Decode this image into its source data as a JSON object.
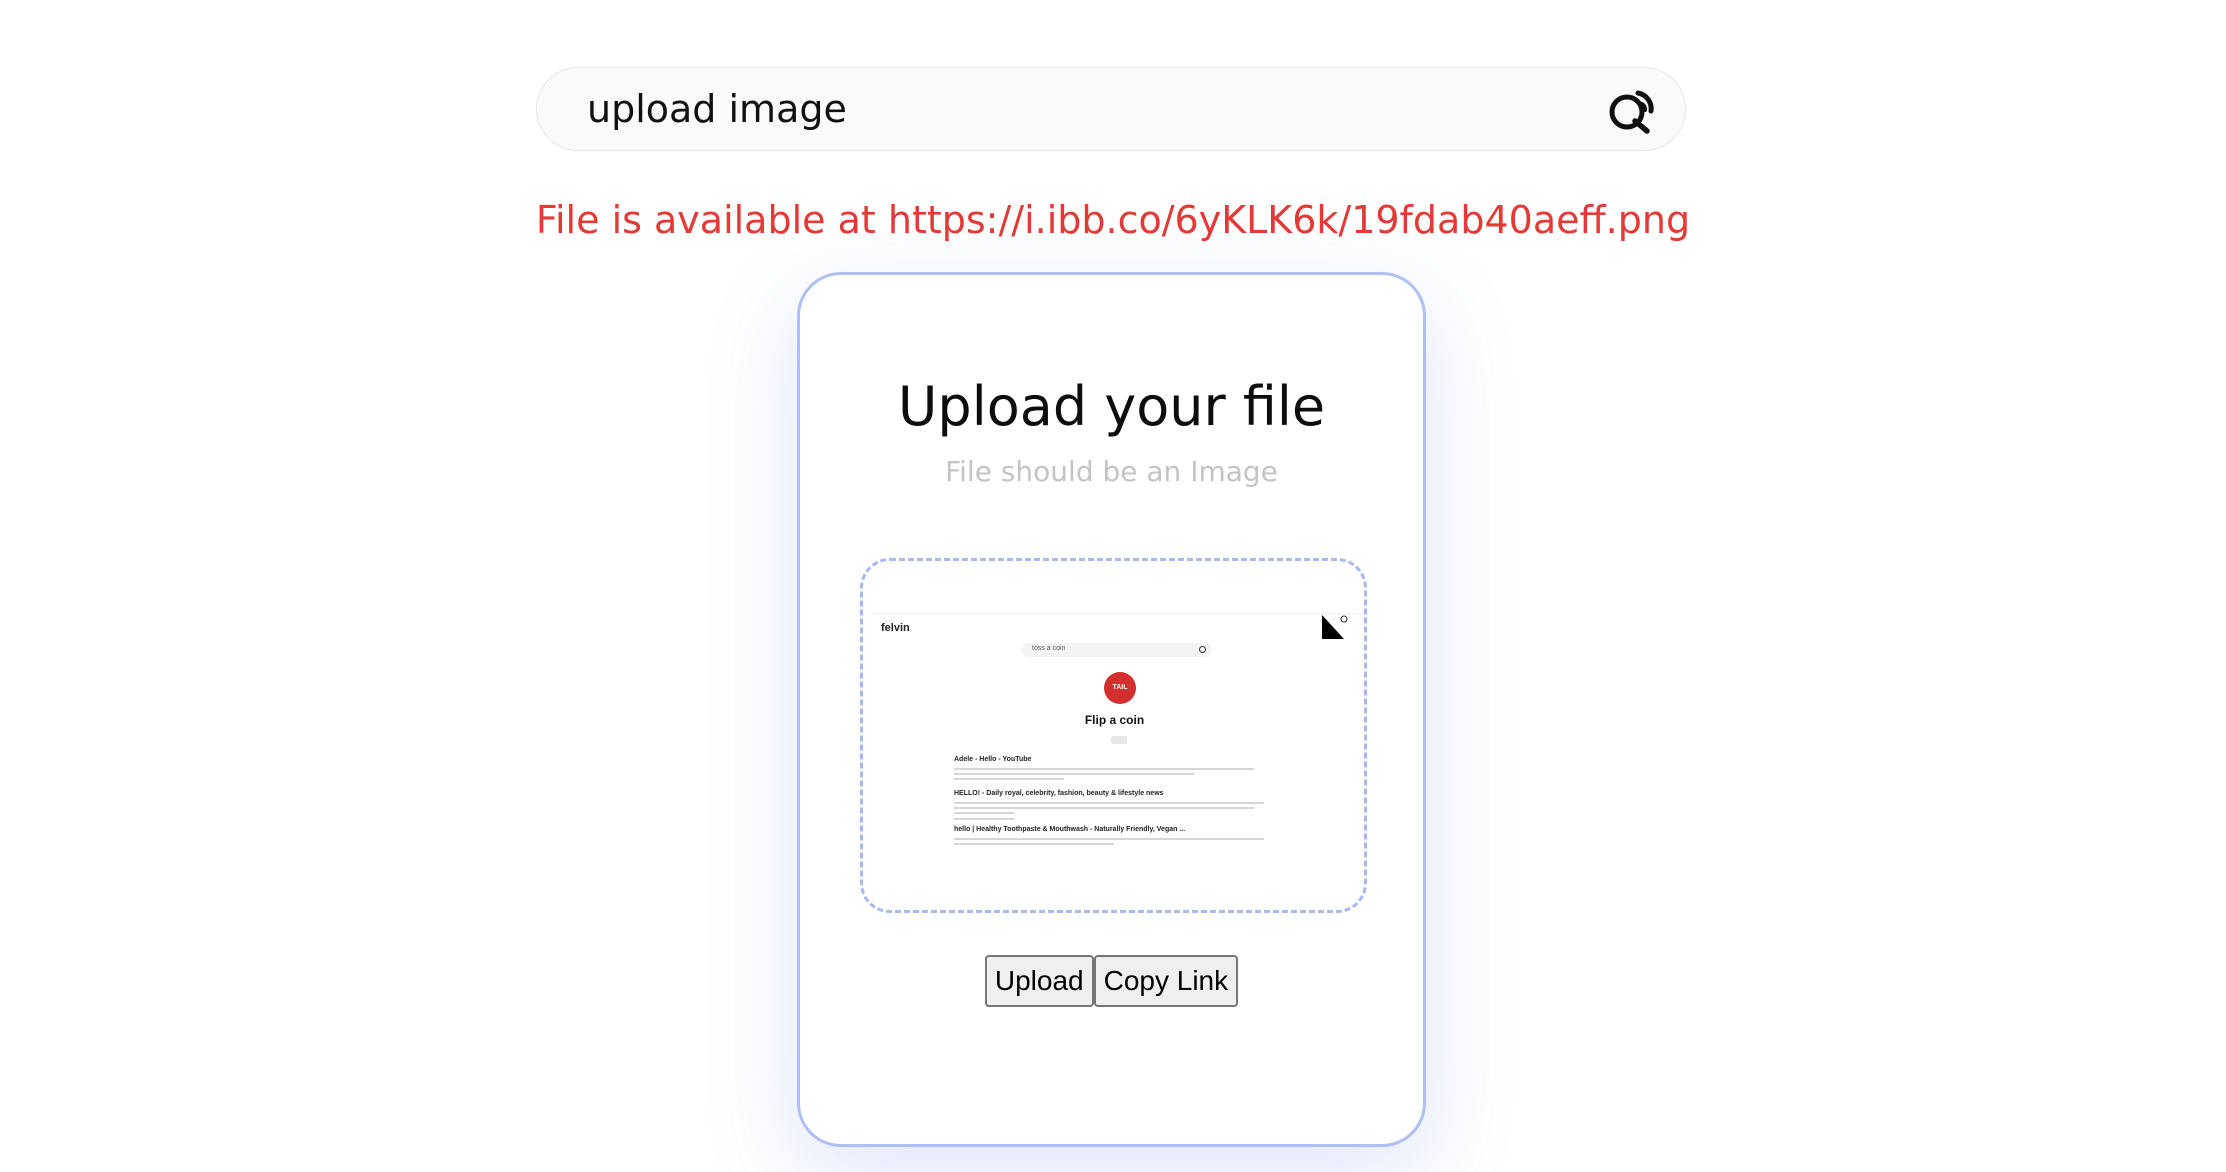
{
  "search": {
    "value": "upload image",
    "icon": "search-icon"
  },
  "status": {
    "message": "File is available at https://i.ibb.co/6yKLK6k/19fdab40aeff.png",
    "color": "#e53935"
  },
  "card": {
    "title": "Upload your file",
    "subtitle": "File should be an Image",
    "accent": "#aebff5",
    "preview": {
      "brand": "felvin",
      "search_text": "toss a coin",
      "coin_label": "TAIL",
      "heading": "Flip a coin",
      "results": [
        "Adele - Hello - YouTube",
        "HELLO! - Daily royal, celebrity, fashion, beauty & lifestyle news",
        "hello | Healthy Toothpaste & Mouthwash - Naturally Friendly, Vegan ..."
      ]
    },
    "buttons": {
      "upload": "Upload",
      "copy_link": "Copy Link"
    }
  }
}
